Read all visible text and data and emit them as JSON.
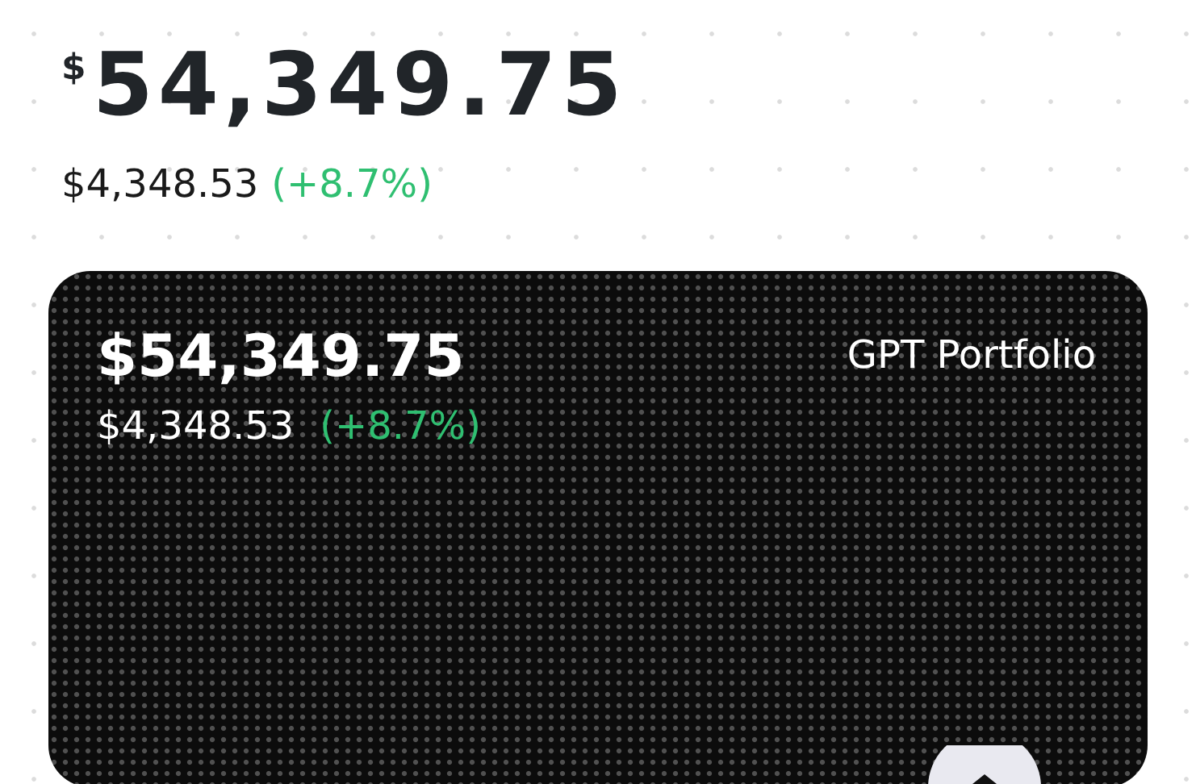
{
  "balance": {
    "currency_symbol": "$",
    "amount": "54,349.75"
  },
  "change": {
    "amount": "$4,348.53",
    "percent": "(+8.7%)"
  },
  "portfolio_card": {
    "amount": "$54,349.75",
    "change_amount": "$4,348.53",
    "change_percent": "(+8.7%)",
    "name": "GPT Portfolio"
  }
}
